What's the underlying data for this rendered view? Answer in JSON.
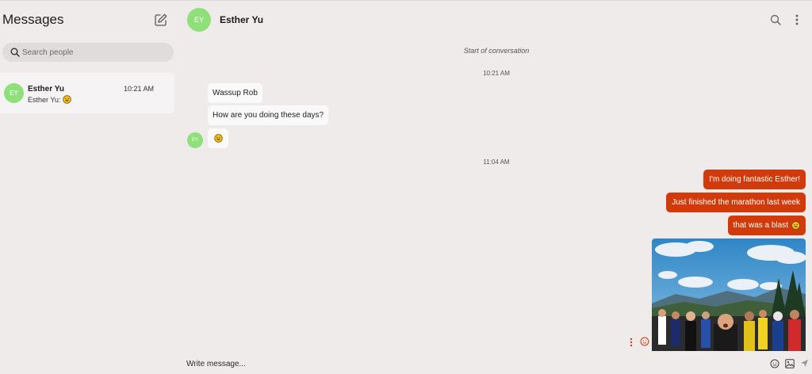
{
  "sidebar": {
    "title": "Messages",
    "search_placeholder": "Search people",
    "conversations": [
      {
        "initials": "EY",
        "name": "Esther Yu",
        "time": "10:21 AM",
        "preview": "Esther Yu:",
        "preview_icon": "grinning-face-emoji",
        "selected": true
      }
    ]
  },
  "header": {
    "initials": "EY",
    "name": "Esther Yu"
  },
  "chat": {
    "start_label": "Start of conversation",
    "groups": [
      {
        "time": "10:21 AM",
        "sender": "Esther Yu",
        "sender_initials": "EY",
        "messages": [
          "Wassup Rob",
          "How are you doing these days?",
          "grinning-face-emoji"
        ]
      },
      {
        "time": "11:04 AM",
        "sender": "me",
        "messages": [
          "I'm doing fantastic Esther!",
          "Just finished the marathon last week",
          "that was a blast",
          "photo"
        ]
      }
    ]
  },
  "composer": {
    "placeholder": "Write message..."
  },
  "icons": {
    "compose": "compose-icon",
    "search": "search-icon",
    "more": "more-vertical-icon",
    "emoji": "emoji-icon",
    "image": "image-icon",
    "send": "send-icon"
  },
  "colors": {
    "background": "#efebea",
    "accent_outgoing": "#d13b0b",
    "avatar": "#8fe07a",
    "incoming_bubble": "#fbfafa",
    "sidebar_selected": "#f5f3f3"
  }
}
